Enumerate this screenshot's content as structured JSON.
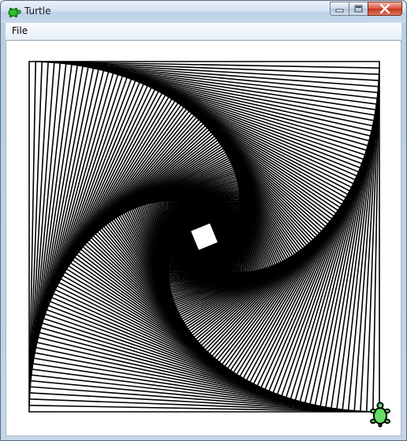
{
  "window": {
    "title": "Turtle",
    "app_icon": "turtle-icon",
    "controls": [
      "minimize-icon",
      "maximize-icon",
      "close-icon"
    ]
  },
  "menu": {
    "items": [
      {
        "label": "File"
      }
    ]
  },
  "colors": {
    "stroke": "#000000",
    "turtle_fill": "#66dd66",
    "canvas_bg": "#ffffff"
  }
}
